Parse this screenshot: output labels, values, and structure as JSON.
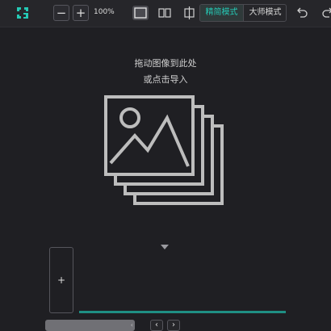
{
  "toolbar": {
    "zoom_out_label": "−",
    "zoom_in_label": "+",
    "zoom_level": "100%",
    "modes": [
      "精简模式",
      "大师模式"
    ],
    "active_mode": "精简模式",
    "icons": [
      "logo-icon",
      "single-view-icon",
      "split-view-icon",
      "crop-icon",
      "undo-icon",
      "redo-icon"
    ]
  },
  "dropzone": {
    "line1": "拖动图像到此处",
    "line2": "或点击导入",
    "icon": "image-stack-icon"
  },
  "filmstrip": {
    "add_label": "+",
    "prev_label": "‹",
    "next_label": "›",
    "scroll_arrow": "‹"
  },
  "colors": {
    "accent": "#25c9b5",
    "background": "#1f1f23",
    "toolbar": "#26262a",
    "track": "#1f8f84"
  }
}
